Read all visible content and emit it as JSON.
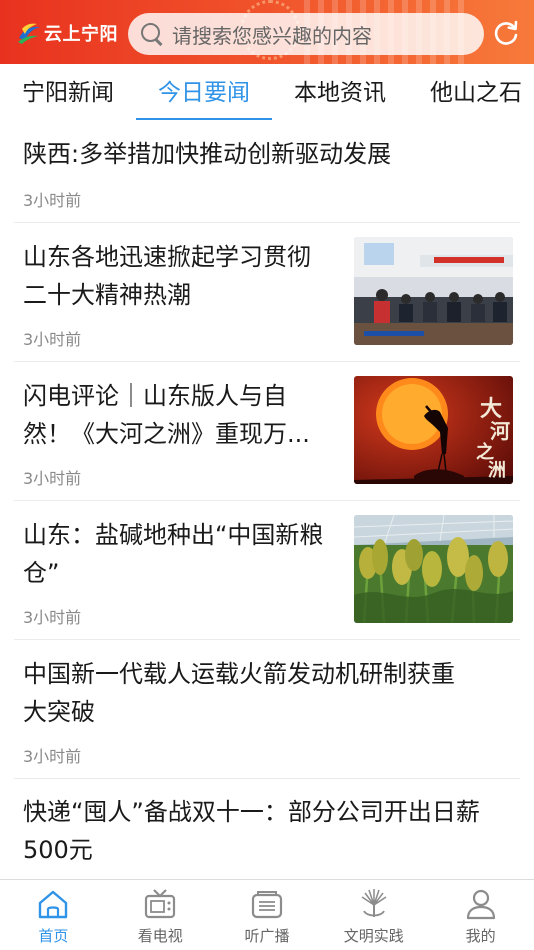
{
  "header": {
    "logo_text": "云上宁阳",
    "search_placeholder": "请搜索您感兴趣的内容",
    "brand_color": "#e8321f"
  },
  "tabs": [
    {
      "label": "宁阳新闻",
      "active": false
    },
    {
      "label": "今日要闻",
      "active": true
    },
    {
      "label": "本地资讯",
      "active": false
    },
    {
      "label": "他山之石",
      "active": false
    }
  ],
  "news": [
    {
      "title": "陕西:多举措加快推动创新驱动发展",
      "time": "3小时前",
      "thumbnail": null
    },
    {
      "title_lines": [
        "山东各地迅速掀起学习贯彻",
        "二十大精神热潮"
      ],
      "time": "3小时前",
      "thumbnail": "meeting-photo"
    },
    {
      "title_lines": [
        "闪电评论｜山东版人与自",
        "然！《大河之洲》重现万..."
      ],
      "time": "3小时前",
      "thumbnail": "stork-sunset-photo",
      "thumb_text": "大河之洲"
    },
    {
      "title_lines": [
        "山东：盐碱地种出“中国新粮",
        "仓”"
      ],
      "time": "3小时前",
      "thumbnail": "millet-field-photo"
    },
    {
      "title_lines": [
        "中国新一代载人运载火箭发动机研制获重",
        "大突破"
      ],
      "time": "3小时前",
      "thumbnail": null
    },
    {
      "title_lines": [
        "快递“囤人”备战双十一：部分公司开出日薪",
        "500元"
      ],
      "time": "",
      "thumbnail": null
    }
  ],
  "bottom_nav": [
    {
      "label": "首页",
      "icon": "home-icon",
      "active": true
    },
    {
      "label": "看电视",
      "icon": "tv-icon",
      "active": false
    },
    {
      "label": "听广播",
      "icon": "radio-icon",
      "active": false
    },
    {
      "label": "文明实践",
      "icon": "emblem-icon",
      "active": false
    },
    {
      "label": "我的",
      "icon": "user-icon",
      "active": false
    }
  ],
  "colors": {
    "accent": "#2f93e8",
    "muted_text": "#8a8a8a"
  }
}
